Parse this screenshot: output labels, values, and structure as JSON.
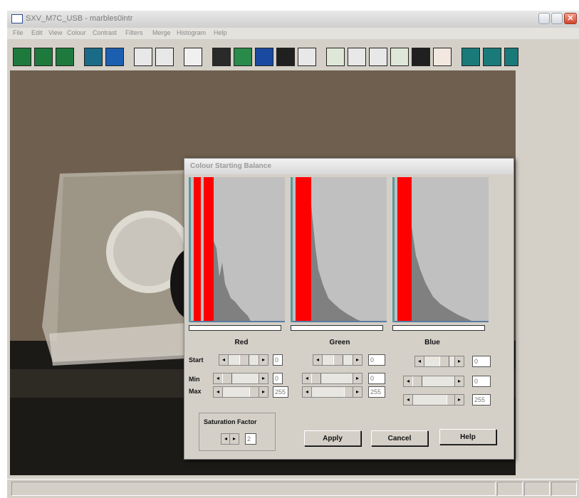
{
  "window": {
    "title": "SXV_M7C_USB - marbles0intr"
  },
  "menu": [
    "File",
    "Edit",
    "View",
    "Colour",
    "Contrast",
    "Filters",
    "Merge",
    "Histogram",
    "Help"
  ],
  "dialog": {
    "title": "Colour Starting Balance",
    "channels": [
      {
        "name": "Red",
        "start": "0",
        "min": "0",
        "max": "255"
      },
      {
        "name": "Green",
        "start": "0",
        "min": "0",
        "max": "255"
      },
      {
        "name": "Blue",
        "start": "0",
        "min": "0",
        "max": "255"
      }
    ],
    "rows": {
      "start": "Start",
      "min": "Min",
      "max": "Max"
    },
    "saturation": {
      "label": "Saturation Factor",
      "value": "2"
    },
    "buttons": {
      "apply": "Apply",
      "cancel": "Cancel",
      "help": "Help"
    }
  },
  "colors": {
    "histogram_marker": "#ff0000",
    "histogram_bars": "#808080",
    "histogram_bg": "#c0c0c0"
  }
}
